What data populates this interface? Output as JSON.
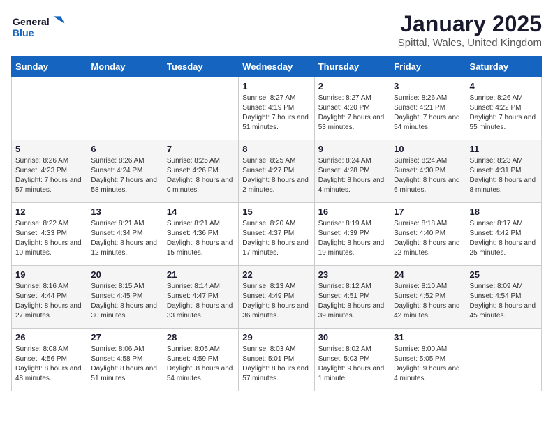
{
  "header": {
    "logo_general": "General",
    "logo_blue": "Blue",
    "title": "January 2025",
    "subtitle": "Spittal, Wales, United Kingdom"
  },
  "weekdays": [
    "Sunday",
    "Monday",
    "Tuesday",
    "Wednesday",
    "Thursday",
    "Friday",
    "Saturday"
  ],
  "weeks": [
    [
      {
        "day": "",
        "sunrise": "",
        "sunset": "",
        "daylight": ""
      },
      {
        "day": "",
        "sunrise": "",
        "sunset": "",
        "daylight": ""
      },
      {
        "day": "",
        "sunrise": "",
        "sunset": "",
        "daylight": ""
      },
      {
        "day": "1",
        "sunrise": "Sunrise: 8:27 AM",
        "sunset": "Sunset: 4:19 PM",
        "daylight": "Daylight: 7 hours and 51 minutes."
      },
      {
        "day": "2",
        "sunrise": "Sunrise: 8:27 AM",
        "sunset": "Sunset: 4:20 PM",
        "daylight": "Daylight: 7 hours and 53 minutes."
      },
      {
        "day": "3",
        "sunrise": "Sunrise: 8:26 AM",
        "sunset": "Sunset: 4:21 PM",
        "daylight": "Daylight: 7 hours and 54 minutes."
      },
      {
        "day": "4",
        "sunrise": "Sunrise: 8:26 AM",
        "sunset": "Sunset: 4:22 PM",
        "daylight": "Daylight: 7 hours and 55 minutes."
      }
    ],
    [
      {
        "day": "5",
        "sunrise": "Sunrise: 8:26 AM",
        "sunset": "Sunset: 4:23 PM",
        "daylight": "Daylight: 7 hours and 57 minutes."
      },
      {
        "day": "6",
        "sunrise": "Sunrise: 8:26 AM",
        "sunset": "Sunset: 4:24 PM",
        "daylight": "Daylight: 7 hours and 58 minutes."
      },
      {
        "day": "7",
        "sunrise": "Sunrise: 8:25 AM",
        "sunset": "Sunset: 4:26 PM",
        "daylight": "Daylight: 8 hours and 0 minutes."
      },
      {
        "day": "8",
        "sunrise": "Sunrise: 8:25 AM",
        "sunset": "Sunset: 4:27 PM",
        "daylight": "Daylight: 8 hours and 2 minutes."
      },
      {
        "day": "9",
        "sunrise": "Sunrise: 8:24 AM",
        "sunset": "Sunset: 4:28 PM",
        "daylight": "Daylight: 8 hours and 4 minutes."
      },
      {
        "day": "10",
        "sunrise": "Sunrise: 8:24 AM",
        "sunset": "Sunset: 4:30 PM",
        "daylight": "Daylight: 8 hours and 6 minutes."
      },
      {
        "day": "11",
        "sunrise": "Sunrise: 8:23 AM",
        "sunset": "Sunset: 4:31 PM",
        "daylight": "Daylight: 8 hours and 8 minutes."
      }
    ],
    [
      {
        "day": "12",
        "sunrise": "Sunrise: 8:22 AM",
        "sunset": "Sunset: 4:33 PM",
        "daylight": "Daylight: 8 hours and 10 minutes."
      },
      {
        "day": "13",
        "sunrise": "Sunrise: 8:21 AM",
        "sunset": "Sunset: 4:34 PM",
        "daylight": "Daylight: 8 hours and 12 minutes."
      },
      {
        "day": "14",
        "sunrise": "Sunrise: 8:21 AM",
        "sunset": "Sunset: 4:36 PM",
        "daylight": "Daylight: 8 hours and 15 minutes."
      },
      {
        "day": "15",
        "sunrise": "Sunrise: 8:20 AM",
        "sunset": "Sunset: 4:37 PM",
        "daylight": "Daylight: 8 hours and 17 minutes."
      },
      {
        "day": "16",
        "sunrise": "Sunrise: 8:19 AM",
        "sunset": "Sunset: 4:39 PM",
        "daylight": "Daylight: 8 hours and 19 minutes."
      },
      {
        "day": "17",
        "sunrise": "Sunrise: 8:18 AM",
        "sunset": "Sunset: 4:40 PM",
        "daylight": "Daylight: 8 hours and 22 minutes."
      },
      {
        "day": "18",
        "sunrise": "Sunrise: 8:17 AM",
        "sunset": "Sunset: 4:42 PM",
        "daylight": "Daylight: 8 hours and 25 minutes."
      }
    ],
    [
      {
        "day": "19",
        "sunrise": "Sunrise: 8:16 AM",
        "sunset": "Sunset: 4:44 PM",
        "daylight": "Daylight: 8 hours and 27 minutes."
      },
      {
        "day": "20",
        "sunrise": "Sunrise: 8:15 AM",
        "sunset": "Sunset: 4:45 PM",
        "daylight": "Daylight: 8 hours and 30 minutes."
      },
      {
        "day": "21",
        "sunrise": "Sunrise: 8:14 AM",
        "sunset": "Sunset: 4:47 PM",
        "daylight": "Daylight: 8 hours and 33 minutes."
      },
      {
        "day": "22",
        "sunrise": "Sunrise: 8:13 AM",
        "sunset": "Sunset: 4:49 PM",
        "daylight": "Daylight: 8 hours and 36 minutes."
      },
      {
        "day": "23",
        "sunrise": "Sunrise: 8:12 AM",
        "sunset": "Sunset: 4:51 PM",
        "daylight": "Daylight: 8 hours and 39 minutes."
      },
      {
        "day": "24",
        "sunrise": "Sunrise: 8:10 AM",
        "sunset": "Sunset: 4:52 PM",
        "daylight": "Daylight: 8 hours and 42 minutes."
      },
      {
        "day": "25",
        "sunrise": "Sunrise: 8:09 AM",
        "sunset": "Sunset: 4:54 PM",
        "daylight": "Daylight: 8 hours and 45 minutes."
      }
    ],
    [
      {
        "day": "26",
        "sunrise": "Sunrise: 8:08 AM",
        "sunset": "Sunset: 4:56 PM",
        "daylight": "Daylight: 8 hours and 48 minutes."
      },
      {
        "day": "27",
        "sunrise": "Sunrise: 8:06 AM",
        "sunset": "Sunset: 4:58 PM",
        "daylight": "Daylight: 8 hours and 51 minutes."
      },
      {
        "day": "28",
        "sunrise": "Sunrise: 8:05 AM",
        "sunset": "Sunset: 4:59 PM",
        "daylight": "Daylight: 8 hours and 54 minutes."
      },
      {
        "day": "29",
        "sunrise": "Sunrise: 8:03 AM",
        "sunset": "Sunset: 5:01 PM",
        "daylight": "Daylight: 8 hours and 57 minutes."
      },
      {
        "day": "30",
        "sunrise": "Sunrise: 8:02 AM",
        "sunset": "Sunset: 5:03 PM",
        "daylight": "Daylight: 9 hours and 1 minute."
      },
      {
        "day": "31",
        "sunrise": "Sunrise: 8:00 AM",
        "sunset": "Sunset: 5:05 PM",
        "daylight": "Daylight: 9 hours and 4 minutes."
      },
      {
        "day": "",
        "sunrise": "",
        "sunset": "",
        "daylight": ""
      }
    ]
  ]
}
